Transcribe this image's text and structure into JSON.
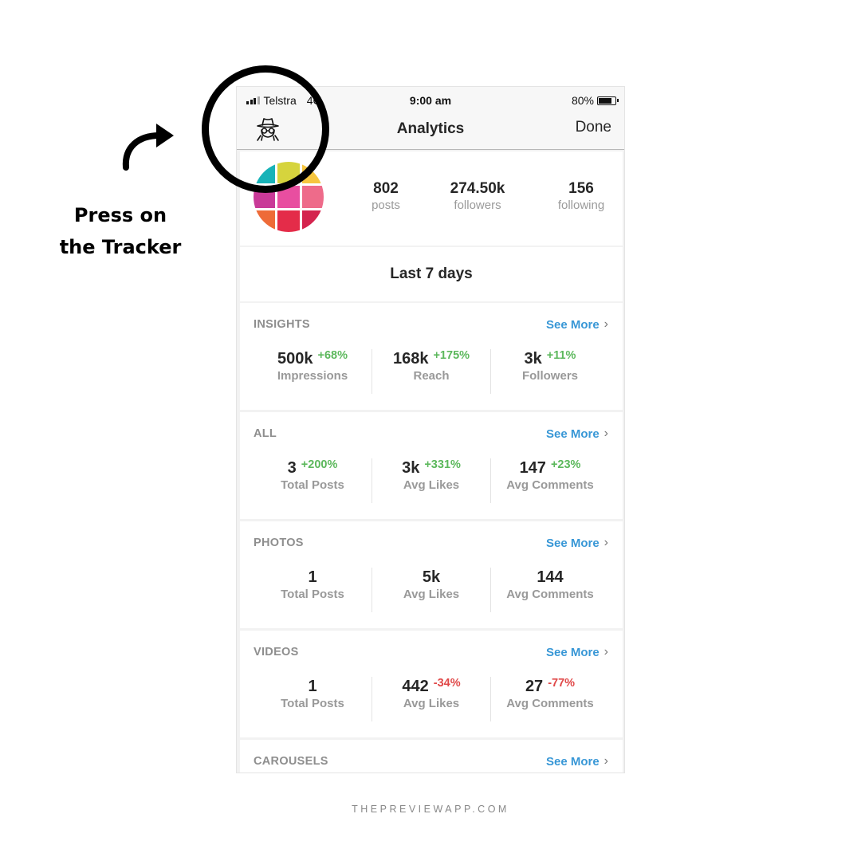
{
  "annotation": {
    "caption_line1": "Press on",
    "caption_line2": "the Tracker",
    "footer": "THEPREVIEWAPP.COM"
  },
  "status_bar": {
    "carrier": "Telstra",
    "network": "4G",
    "time": "9:00 am",
    "battery_percent": "80%",
    "battery_level": 0.8
  },
  "nav": {
    "left_icon": "spy-tracker-icon",
    "title": "Analytics",
    "done_label": "Done"
  },
  "profile": {
    "avatar_colors": [
      "#17b3b8",
      "#d6d43d",
      "#f6c640",
      "#c93a98",
      "#e84ea0",
      "#ee6b8a",
      "#ee6b38",
      "#e42c49",
      "#d4244e"
    ],
    "stats": [
      {
        "value": "802",
        "label": "posts"
      },
      {
        "value": "274.50k",
        "label": "followers"
      },
      {
        "value": "156",
        "label": "following"
      }
    ]
  },
  "period": "Last 7 days",
  "colors": {
    "accent": "#3897d6",
    "positive": "#5cb85c",
    "negative": "#e04848"
  },
  "sections": [
    {
      "title": "INSIGHTS",
      "see_more": "See More",
      "metrics": [
        {
          "value": "500k",
          "change": "+68%",
          "trend": "up",
          "label": "Impressions"
        },
        {
          "value": "168k",
          "change": "+175%",
          "trend": "up",
          "label": "Reach"
        },
        {
          "value": "3k",
          "change": "+11%",
          "trend": "up",
          "label": "Followers"
        }
      ]
    },
    {
      "title": "ALL",
      "see_more": "See More",
      "metrics": [
        {
          "value": "3",
          "change": "+200%",
          "trend": "up",
          "label": "Total Posts"
        },
        {
          "value": "3k",
          "change": "+331%",
          "trend": "up",
          "label": "Avg Likes"
        },
        {
          "value": "147",
          "change": "+23%",
          "trend": "up",
          "label": "Avg Comments"
        }
      ]
    },
    {
      "title": "PHOTOS",
      "see_more": "See More",
      "metrics": [
        {
          "value": "1",
          "change": "",
          "trend": "",
          "label": "Total Posts"
        },
        {
          "value": "5k",
          "change": "",
          "trend": "",
          "label": "Avg Likes"
        },
        {
          "value": "144",
          "change": "",
          "trend": "",
          "label": "Avg Comments"
        }
      ]
    },
    {
      "title": "VIDEOS",
      "see_more": "See More",
      "metrics": [
        {
          "value": "1",
          "change": "",
          "trend": "",
          "label": "Total Posts"
        },
        {
          "value": "442",
          "change": "-34%",
          "trend": "down",
          "label": "Avg Likes"
        },
        {
          "value": "27",
          "change": "-77%",
          "trend": "down",
          "label": "Avg Comments"
        }
      ]
    },
    {
      "title": "CAROUSELS",
      "see_more": "See More",
      "metrics": []
    }
  ]
}
